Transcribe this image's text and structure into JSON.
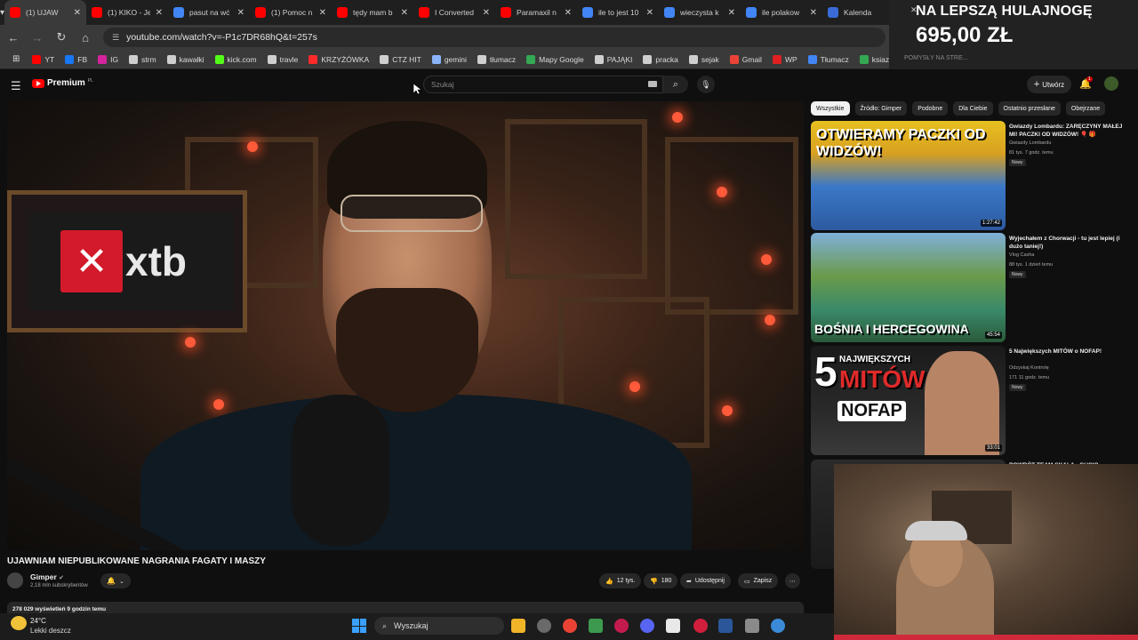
{
  "browser": {
    "tabs": [
      {
        "label": "(1) UJAW",
        "active": true,
        "fav_color": "#ff0000"
      },
      {
        "label": "(1) KIKO - Je",
        "fav_color": "#ff0000"
      },
      {
        "label": "pasut na wć",
        "fav_color": "#4285f4"
      },
      {
        "label": "(1) Pomoc n",
        "fav_color": "#ff0000"
      },
      {
        "label": "tędy mam b",
        "fav_color": "#ff0000"
      },
      {
        "label": "I Converted",
        "fav_color": "#ff0000"
      },
      {
        "label": "Paramaxil n",
        "fav_color": "#ff0000"
      },
      {
        "label": "ile to jest 10",
        "fav_color": "#4285f4"
      },
      {
        "label": "wieczysta k",
        "fav_color": "#4285f4"
      },
      {
        "label": "ile polakow",
        "fav_color": "#4285f4"
      },
      {
        "label": "Kalenda",
        "fav_color": "#3a6bd8"
      }
    ],
    "url": "youtube.com/watch?v=-P1c7DR68hQ&t=257s",
    "bookmarks": [
      {
        "label": "YT",
        "color": "#ff0000"
      },
      {
        "label": "FB",
        "color": "#1877f2"
      },
      {
        "label": "IG",
        "color": "#d6249f"
      },
      {
        "label": "strm",
        "color": "#cfcfcf"
      },
      {
        "label": "kawałki",
        "color": "#cfcfcf"
      },
      {
        "label": "kick.com",
        "color": "#53fc18"
      },
      {
        "label": "travle",
        "color": "#cfcfcf"
      },
      {
        "label": "KRZYŻÓWKA",
        "color": "#ff2a2a"
      },
      {
        "label": "CTZ HIT",
        "color": "#cfcfcf"
      },
      {
        "label": "gemini",
        "color": "#8ab4f8"
      },
      {
        "label": "tłumacz",
        "color": "#cfcfcf"
      },
      {
        "label": "Mapy Google",
        "color": "#34a853"
      },
      {
        "label": "PAJĄKI",
        "color": "#cfcfcf"
      },
      {
        "label": "pracka",
        "color": "#cfcfcf"
      },
      {
        "label": "sejak",
        "color": "#cfcfcf"
      },
      {
        "label": "Gmail",
        "color": "#ea4335"
      },
      {
        "label": "WP",
        "color": "#e02020"
      },
      {
        "label": "Tłumacz",
        "color": "#4285f4"
      },
      {
        "label": "ksiazka",
        "color": "#34a853"
      }
    ]
  },
  "ad": {
    "line1": "NA LEPSZĄ HULAJNOGĘ",
    "line2": "695,00 ZŁ",
    "sub": "POMYSŁY NA STRE..."
  },
  "youtube": {
    "logo_text": "Premium",
    "logo_region": "PL",
    "search_placeholder": "Szukaj",
    "create_label": "Utwórz",
    "notif_count": "1",
    "video": {
      "sign_text": "xtb",
      "title": "UJAWNIAM NIEPUBLIKOWANE NAGRANIA FAGATY I MASZY",
      "channel": "Gimper",
      "subscribers": "2,18 mln subskrybentów",
      "likes": "12 tys.",
      "dislikes": "180",
      "share_label": "Udostępnij",
      "save_label": "Zapisz",
      "views_line": "278 029 wyświetleń  9 godzin temu"
    },
    "chips": [
      "Wszystkie",
      "Źródło: Gimper",
      "Podobne",
      "Dla Ciebie",
      "Ostatnio przesłane",
      "Obejrzane"
    ],
    "recommendations": [
      {
        "title": "Gwiazdy Lombardu: ZARĘCZYNY MAŁEJ MI! PACZKI OD WIDZÓW! 🎈 🎁",
        "channel": "Gwiazdy Lombardu",
        "meta": "81 tys.  7 godz. temu",
        "badge": "Nowy",
        "duration": "1:27:42",
        "thumb_text": "OTWIERAMY PACZKI OD WIDZÓW!"
      },
      {
        "title": "Wyjechałem z Chorwacji - tu jest lepiej (i dużo taniej!)",
        "channel": "Vlog Casha",
        "meta": "88 tys.  1 dzień temu",
        "badge": "Nowy",
        "duration": "45:54",
        "thumb_text": "BOŚNIA I HERCEGOWINA"
      },
      {
        "title": "5 Największych MITÓW o NOFAP!",
        "channel": "Odzyskaj Kontrolę",
        "meta": "171  11 godz. temu",
        "badge": "Nowy",
        "duration": "33:01",
        "thumb_text_a": "5",
        "thumb_text_b": "NAJWIĘKSZYCH",
        "thumb_text_c": "MITÓW",
        "thumb_text_d": "NOFAP"
      },
      {
        "title": "POWRÓT TEAM SKALA - GUCIO",
        "channel": "",
        "meta": "",
        "badge": "",
        "duration": "",
        "thumb_text": ""
      }
    ]
  },
  "taskbar": {
    "temperature": "24°C",
    "weather": "Lekki deszcz",
    "search_label": "Wyszukaj"
  }
}
